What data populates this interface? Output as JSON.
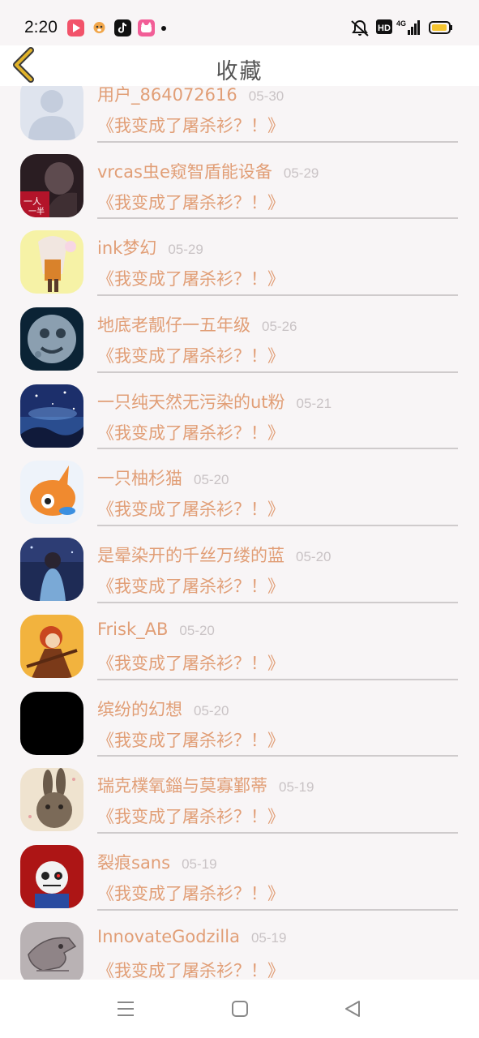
{
  "status_bar": {
    "time": "2:20",
    "notification_icons": [
      {
        "name": "video-app-icon",
        "color": "#f2536a"
      },
      {
        "name": "dog-app-icon",
        "color": "#f1a64a"
      },
      {
        "name": "tiktok-icon",
        "color": "#111111"
      },
      {
        "name": "cat-app-icon",
        "color": "#f25e97"
      }
    ],
    "indicators": [
      "mute-icon",
      "hd-icon",
      "network-4g-icon",
      "battery-icon"
    ],
    "battery_color": "#f4c430"
  },
  "header": {
    "title": "收藏",
    "back_icon": "chevron-left-icon",
    "back_color": "#e0b22a"
  },
  "favorites": [
    {
      "user": "用户_864072616",
      "date": "05-30",
      "title": "《我变成了屠杀衫？！》",
      "avatar": "default-avatar"
    },
    {
      "user": "vrcas虫e窥智盾能设备",
      "date": "05-29",
      "title": "《我变成了屠杀衫？！》",
      "avatar": "dark-portrait-avatar"
    },
    {
      "user": "ink梦幻",
      "date": "05-29",
      "title": "《我变成了屠杀衫？！》",
      "avatar": "anime-girl-avatar"
    },
    {
      "user": "地底老靓仔一五年级",
      "date": "05-26",
      "title": "《我变成了屠杀衫？！》",
      "avatar": "moon-face-avatar"
    },
    {
      "user": "一只纯天然无污染的ut粉",
      "date": "05-21",
      "title": "《我变成了屠杀衫？！》",
      "avatar": "night-sky-avatar"
    },
    {
      "user": "一只柚杉猫",
      "date": "05-20",
      "title": "《我变成了屠杀衫？！》",
      "avatar": "orange-creature-avatar"
    },
    {
      "user": "是晕染开的千丝万缕的蓝",
      "date": "05-20",
      "title": "《我变成了屠杀衫？！》",
      "avatar": "blue-girl-avatar"
    },
    {
      "user": "Frisk_AB",
      "date": "05-20",
      "title": "《我变成了屠杀衫？！》",
      "avatar": "red-hair-avatar"
    },
    {
      "user": "缤纷的幻想",
      "date": "05-20",
      "title": "《我变成了屠杀衫？！》",
      "avatar": "black-avatar"
    },
    {
      "user": "瑞克樸氧錙与莫寡鄞蒂",
      "date": "05-19",
      "title": "《我变成了屠杀衫？！》",
      "avatar": "rabbit-avatar"
    },
    {
      "user": "裂痕sans",
      "date": "05-19",
      "title": "《我变成了屠杀衫？！》",
      "avatar": "red-sans-avatar"
    },
    {
      "user": "InnovateGodzilla",
      "date": "05-19",
      "title": "《我变成了屠杀衫？！》",
      "avatar": "dragon-sketch-avatar"
    }
  ],
  "nav_bar": {
    "buttons": [
      "menu-icon",
      "home-icon",
      "back-triangle-icon"
    ]
  },
  "colors": {
    "accent_text": "#e19e76",
    "date_text": "#c9c3c5",
    "background": "#f8f5f6"
  }
}
